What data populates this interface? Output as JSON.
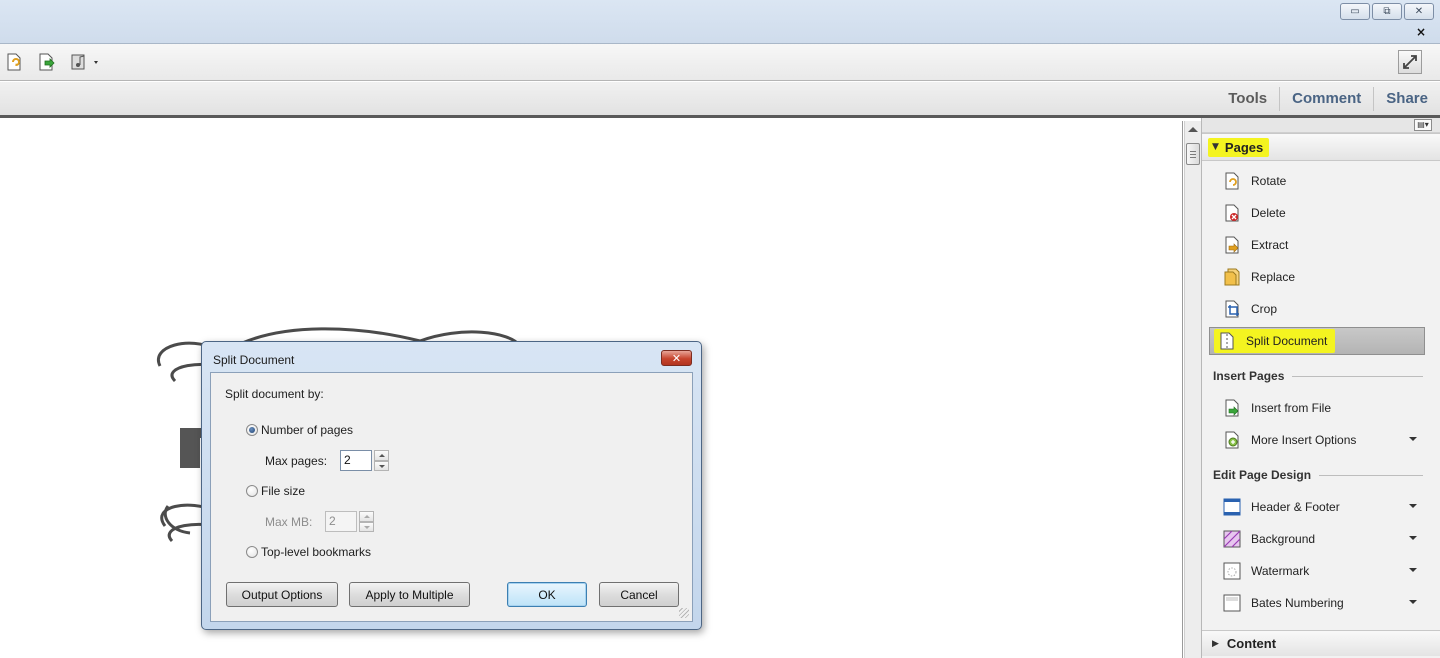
{
  "window": {
    "minimize_glyph": "▭",
    "restore_glyph": "⧉",
    "close_glyph": "✕",
    "doc_close_glyph": "×"
  },
  "toolbar": {
    "icons": [
      "page-rotate-icon",
      "insert-page-icon",
      "audio-video-icon"
    ],
    "expand_icon": "fullscreen-expand-icon"
  },
  "tabs": [
    "Tools",
    "Comment",
    "Share"
  ],
  "panel": {
    "options_glyph": "▤▾",
    "pages_section": {
      "title": "Pages",
      "expanded_glyph": "▼",
      "items": [
        {
          "label": "Rotate",
          "icon": "rotate-page-icon"
        },
        {
          "label": "Delete",
          "icon": "delete-page-icon"
        },
        {
          "label": "Extract",
          "icon": "extract-page-icon"
        },
        {
          "label": "Replace",
          "icon": "replace-page-icon"
        },
        {
          "label": "Crop",
          "icon": "crop-page-icon"
        },
        {
          "label": "Split Document",
          "icon": "split-document-icon",
          "selected": true
        }
      ]
    },
    "insert_pages": {
      "title": "Insert Pages",
      "items": [
        {
          "label": "Insert from File",
          "icon": "insert-from-file-icon"
        },
        {
          "label": "More Insert Options",
          "icon": "more-insert-options-icon",
          "dropdown": true
        }
      ]
    },
    "edit_page_design": {
      "title": "Edit Page Design",
      "items": [
        {
          "label": "Header & Footer",
          "icon": "header-footer-icon",
          "dropdown": true
        },
        {
          "label": "Background",
          "icon": "background-icon",
          "dropdown": true
        },
        {
          "label": "Watermark",
          "icon": "watermark-icon",
          "dropdown": true
        },
        {
          "label": "Bates Numbering",
          "icon": "bates-numbering-icon",
          "dropdown": true
        }
      ]
    },
    "content_section": {
      "title": "Content",
      "collapsed_glyph": "▶"
    }
  },
  "dialog": {
    "title": "Split Document",
    "close_glyph": "✕",
    "split_by_label": "Split document by:",
    "options": {
      "number_of_pages": {
        "label": "Number of pages",
        "checked": true
      },
      "max_pages_label": "Max pages:",
      "max_pages_value": "2",
      "file_size": {
        "label": "File size",
        "checked": false
      },
      "max_mb_label": "Max MB:",
      "max_mb_value": "2",
      "top_level_bookmarks": {
        "label": "Top-level bookmarks",
        "checked": false
      }
    },
    "buttons": {
      "output_options": "Output Options",
      "apply_to_multiple": "Apply to Multiple",
      "ok": "OK",
      "cancel": "Cancel"
    }
  },
  "colors": {
    "highlight": "#f4f420",
    "tab_text": "#4a6484",
    "dialog_frame": "#c3d6ec",
    "dialog_close": "#c7442d"
  }
}
